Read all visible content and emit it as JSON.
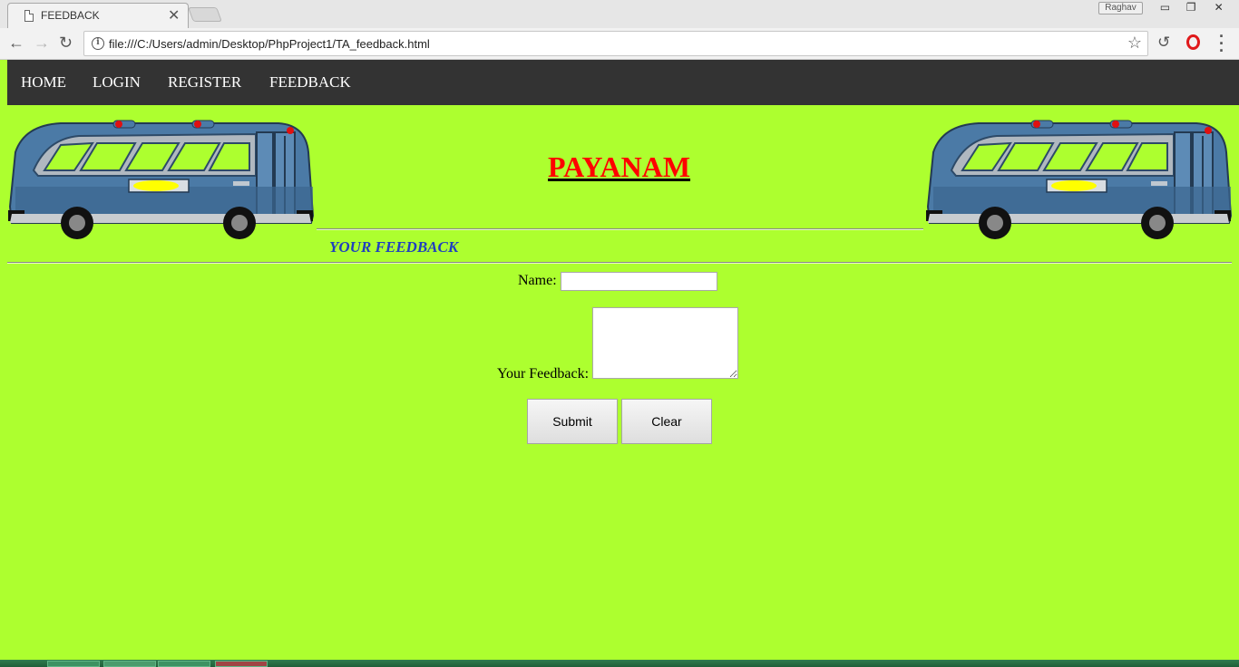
{
  "browser": {
    "tab_title": "FEEDBACK",
    "tab_close": "✕",
    "profile_name": "Raghav",
    "url": "file:///C:/Users/admin/Desktop/PhpProject1/TA_feedback.html",
    "window_controls": {
      "minimize": "▭",
      "restore": "❐",
      "close": "✕"
    },
    "nav": {
      "back": "←",
      "forward": "→",
      "reload": "↻"
    },
    "icons": [
      "document-icon",
      "info-icon",
      "star-icon",
      "history-icon",
      "opera-icon",
      "menu-icon"
    ]
  },
  "page": {
    "nav_links": [
      "HOME",
      "LOGIN",
      "REGISTER",
      "FEEDBACK"
    ],
    "site_title": "PAYANAM",
    "section_heading": "YOUR FEEDBACK",
    "form": {
      "name_label": "Name:",
      "name_value": "",
      "feedback_label": "Your Feedback:",
      "feedback_value": "",
      "submit_label": "Submit",
      "clear_label": "Clear"
    },
    "colors": {
      "background": "#adff2f",
      "navbar": "#333333",
      "title": "#ff0000",
      "heading": "#1f3fbf",
      "bus_body": "#4b7aa6"
    }
  }
}
